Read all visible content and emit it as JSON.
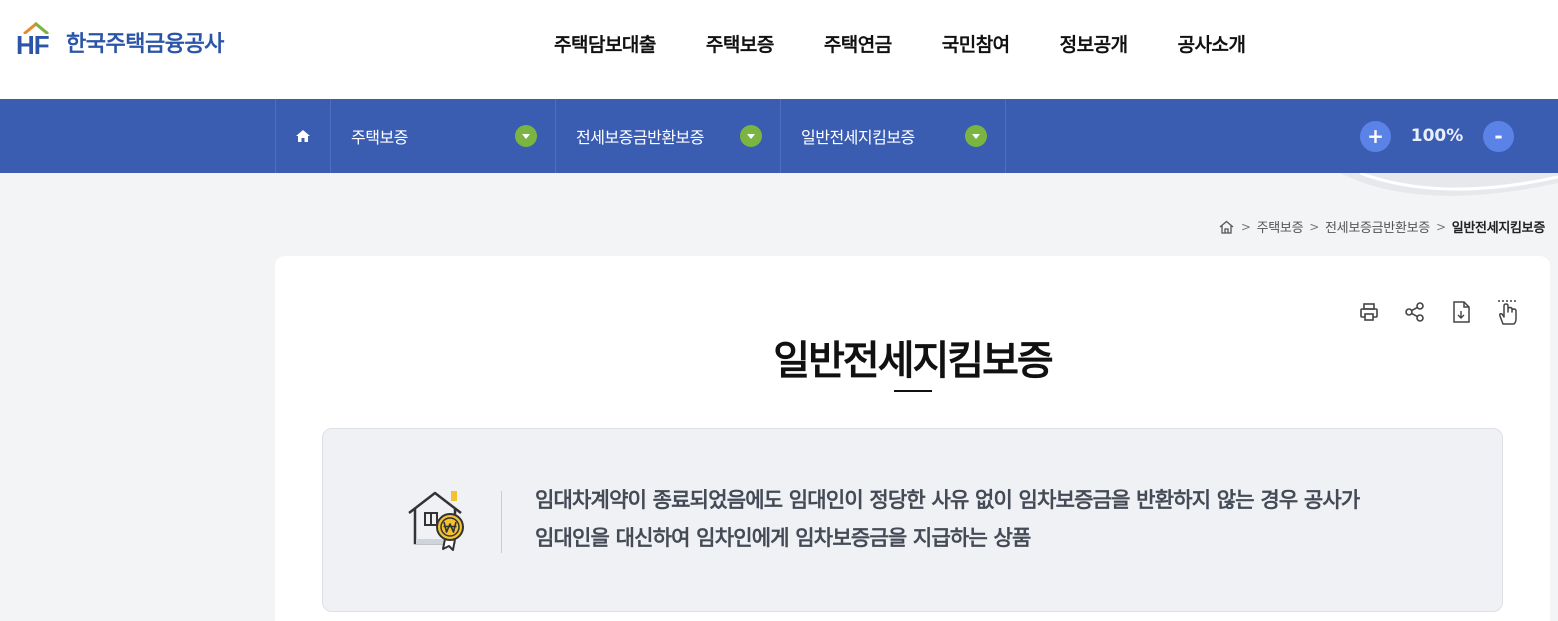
{
  "header": {
    "logo_mark": "HF",
    "logo_text": "한국주택금융공사",
    "nav": [
      "주택담보대출",
      "주택보증",
      "주택연금",
      "국민참여",
      "정보공개",
      "공사소개"
    ]
  },
  "locbar": {
    "home_icon": "home-icon",
    "dropdowns": [
      "주택보증",
      "전세보증금반환보증",
      "일반전세지킴보증"
    ],
    "zoom_plus": "+",
    "zoom_value": "100%",
    "zoom_minus": "-"
  },
  "breadcrumb": {
    "items": [
      "주택보증",
      "전세보증금반환보증"
    ],
    "current": "일반전세지킴보증",
    "separator": ">"
  },
  "page": {
    "title": "일반전세지킴보증",
    "tools": [
      "print-icon",
      "share-icon",
      "download-icon",
      "touch-icon"
    ],
    "summary_line1": "임대차계약이 종료되었음에도 임대인이 정당한 사유 없이 임차보증금을 반환하지 않는 경우 공사가",
    "summary_line2": "임대인을 대신하여 임차인에게 임차보증금을 지급하는 상품"
  },
  "colors": {
    "brand_blue": "#2c55a8",
    "locbar_bg": "#3a5db2",
    "dropdown_arrow": "#7bb541",
    "zoom_button": "#5b82e6"
  }
}
